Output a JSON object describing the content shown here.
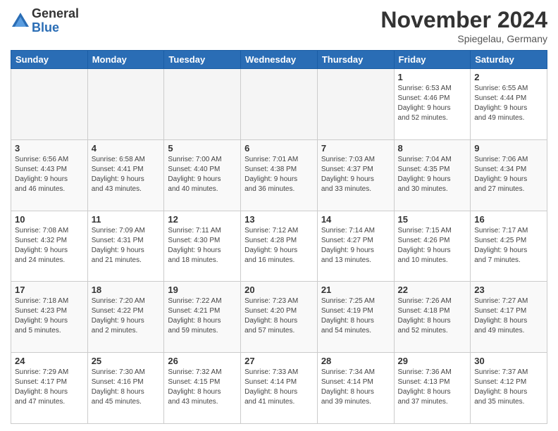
{
  "header": {
    "logo_general": "General",
    "logo_blue": "Blue",
    "month_title": "November 2024",
    "location": "Spiegelau, Germany"
  },
  "weekdays": [
    "Sunday",
    "Monday",
    "Tuesday",
    "Wednesday",
    "Thursday",
    "Friday",
    "Saturday"
  ],
  "weeks": [
    [
      {
        "day": "",
        "detail": ""
      },
      {
        "day": "",
        "detail": ""
      },
      {
        "day": "",
        "detail": ""
      },
      {
        "day": "",
        "detail": ""
      },
      {
        "day": "",
        "detail": ""
      },
      {
        "day": "1",
        "detail": "Sunrise: 6:53 AM\nSunset: 4:46 PM\nDaylight: 9 hours\nand 52 minutes."
      },
      {
        "day": "2",
        "detail": "Sunrise: 6:55 AM\nSunset: 4:44 PM\nDaylight: 9 hours\nand 49 minutes."
      }
    ],
    [
      {
        "day": "3",
        "detail": "Sunrise: 6:56 AM\nSunset: 4:43 PM\nDaylight: 9 hours\nand 46 minutes."
      },
      {
        "day": "4",
        "detail": "Sunrise: 6:58 AM\nSunset: 4:41 PM\nDaylight: 9 hours\nand 43 minutes."
      },
      {
        "day": "5",
        "detail": "Sunrise: 7:00 AM\nSunset: 4:40 PM\nDaylight: 9 hours\nand 40 minutes."
      },
      {
        "day": "6",
        "detail": "Sunrise: 7:01 AM\nSunset: 4:38 PM\nDaylight: 9 hours\nand 36 minutes."
      },
      {
        "day": "7",
        "detail": "Sunrise: 7:03 AM\nSunset: 4:37 PM\nDaylight: 9 hours\nand 33 minutes."
      },
      {
        "day": "8",
        "detail": "Sunrise: 7:04 AM\nSunset: 4:35 PM\nDaylight: 9 hours\nand 30 minutes."
      },
      {
        "day": "9",
        "detail": "Sunrise: 7:06 AM\nSunset: 4:34 PM\nDaylight: 9 hours\nand 27 minutes."
      }
    ],
    [
      {
        "day": "10",
        "detail": "Sunrise: 7:08 AM\nSunset: 4:32 PM\nDaylight: 9 hours\nand 24 minutes."
      },
      {
        "day": "11",
        "detail": "Sunrise: 7:09 AM\nSunset: 4:31 PM\nDaylight: 9 hours\nand 21 minutes."
      },
      {
        "day": "12",
        "detail": "Sunrise: 7:11 AM\nSunset: 4:30 PM\nDaylight: 9 hours\nand 18 minutes."
      },
      {
        "day": "13",
        "detail": "Sunrise: 7:12 AM\nSunset: 4:28 PM\nDaylight: 9 hours\nand 16 minutes."
      },
      {
        "day": "14",
        "detail": "Sunrise: 7:14 AM\nSunset: 4:27 PM\nDaylight: 9 hours\nand 13 minutes."
      },
      {
        "day": "15",
        "detail": "Sunrise: 7:15 AM\nSunset: 4:26 PM\nDaylight: 9 hours\nand 10 minutes."
      },
      {
        "day": "16",
        "detail": "Sunrise: 7:17 AM\nSunset: 4:25 PM\nDaylight: 9 hours\nand 7 minutes."
      }
    ],
    [
      {
        "day": "17",
        "detail": "Sunrise: 7:18 AM\nSunset: 4:23 PM\nDaylight: 9 hours\nand 5 minutes."
      },
      {
        "day": "18",
        "detail": "Sunrise: 7:20 AM\nSunset: 4:22 PM\nDaylight: 9 hours\nand 2 minutes."
      },
      {
        "day": "19",
        "detail": "Sunrise: 7:22 AM\nSunset: 4:21 PM\nDaylight: 8 hours\nand 59 minutes."
      },
      {
        "day": "20",
        "detail": "Sunrise: 7:23 AM\nSunset: 4:20 PM\nDaylight: 8 hours\nand 57 minutes."
      },
      {
        "day": "21",
        "detail": "Sunrise: 7:25 AM\nSunset: 4:19 PM\nDaylight: 8 hours\nand 54 minutes."
      },
      {
        "day": "22",
        "detail": "Sunrise: 7:26 AM\nSunset: 4:18 PM\nDaylight: 8 hours\nand 52 minutes."
      },
      {
        "day": "23",
        "detail": "Sunrise: 7:27 AM\nSunset: 4:17 PM\nDaylight: 8 hours\nand 49 minutes."
      }
    ],
    [
      {
        "day": "24",
        "detail": "Sunrise: 7:29 AM\nSunset: 4:17 PM\nDaylight: 8 hours\nand 47 minutes."
      },
      {
        "day": "25",
        "detail": "Sunrise: 7:30 AM\nSunset: 4:16 PM\nDaylight: 8 hours\nand 45 minutes."
      },
      {
        "day": "26",
        "detail": "Sunrise: 7:32 AM\nSunset: 4:15 PM\nDaylight: 8 hours\nand 43 minutes."
      },
      {
        "day": "27",
        "detail": "Sunrise: 7:33 AM\nSunset: 4:14 PM\nDaylight: 8 hours\nand 41 minutes."
      },
      {
        "day": "28",
        "detail": "Sunrise: 7:34 AM\nSunset: 4:14 PM\nDaylight: 8 hours\nand 39 minutes."
      },
      {
        "day": "29",
        "detail": "Sunrise: 7:36 AM\nSunset: 4:13 PM\nDaylight: 8 hours\nand 37 minutes."
      },
      {
        "day": "30",
        "detail": "Sunrise: 7:37 AM\nSunset: 4:12 PM\nDaylight: 8 hours\nand 35 minutes."
      }
    ]
  ]
}
